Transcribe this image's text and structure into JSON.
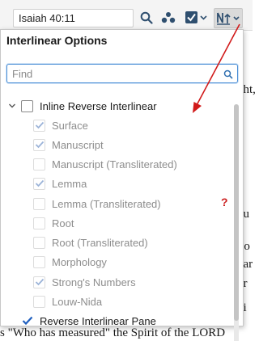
{
  "toolbar": {
    "reference": "Isaiah 40:11",
    "icons": [
      "search-icon",
      "people-icon",
      "checkbox-dropdown-icon",
      "interlinear-dropdown-icon"
    ]
  },
  "document": {
    "fragments": [
      "ght,",
      "ou",
      "llo",
      "oar",
      "ur",
      "ui"
    ],
    "bottom_line": "s \"Who has measured\" the Spirit of the LORD"
  },
  "panel": {
    "title": "Interlinear Options",
    "find_placeholder": "Find",
    "find_value": "",
    "help_mark": "?",
    "parent": {
      "label": "Inline Reverse Interlinear",
      "checked": false
    },
    "items": [
      {
        "label": "Surface",
        "checked": true
      },
      {
        "label": "Manuscript",
        "checked": true
      },
      {
        "label": "Manuscript (Transliterated)",
        "checked": false
      },
      {
        "label": "Lemma",
        "checked": true
      },
      {
        "label": "Lemma (Transliterated)",
        "checked": false
      },
      {
        "label": "Root",
        "checked": false
      },
      {
        "label": "Root (Transliterated)",
        "checked": false
      },
      {
        "label": "Morphology",
        "checked": false
      },
      {
        "label": "Strong's Numbers",
        "checked": true
      },
      {
        "label": "Louw-Nida",
        "checked": false
      }
    ],
    "pane": {
      "label": "Reverse Interlinear Pane",
      "checked": true
    }
  },
  "colors": {
    "accent": "#1f5fbf",
    "annotation_arrow": "#d11a1a",
    "help": "#cc2020",
    "dim_check": "#9bb3d8"
  }
}
